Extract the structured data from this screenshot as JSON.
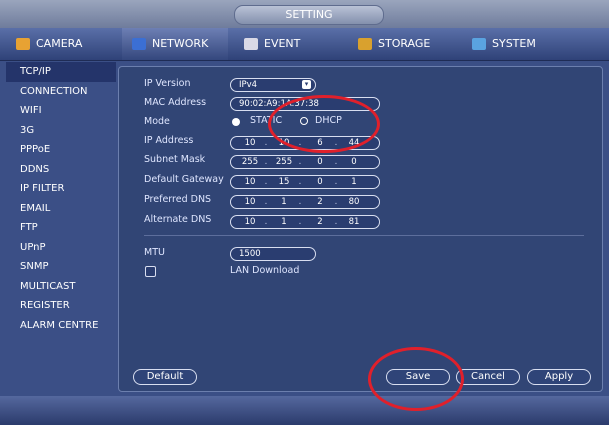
{
  "window": {
    "title": "SETTING"
  },
  "tabs": [
    {
      "label": "CAMERA",
      "icon": "camera-icon",
      "active": false
    },
    {
      "label": "NETWORK",
      "icon": "network-icon",
      "active": true
    },
    {
      "label": "EVENT",
      "icon": "event-icon",
      "active": false
    },
    {
      "label": "STORAGE",
      "icon": "storage-icon",
      "active": false
    },
    {
      "label": "SYSTEM",
      "icon": "system-icon",
      "active": false
    }
  ],
  "sidebar": {
    "items": [
      {
        "label": "TCP/IP",
        "active": true
      },
      {
        "label": "CONNECTION"
      },
      {
        "label": "WIFI"
      },
      {
        "label": "3G"
      },
      {
        "label": "PPPoE"
      },
      {
        "label": "DDNS"
      },
      {
        "label": "IP FILTER"
      },
      {
        "label": "EMAIL"
      },
      {
        "label": "FTP"
      },
      {
        "label": "UPnP"
      },
      {
        "label": "SNMP"
      },
      {
        "label": "MULTICAST"
      },
      {
        "label": "REGISTER"
      },
      {
        "label": "ALARM CENTRE"
      }
    ]
  },
  "form": {
    "ip_version": {
      "label": "IP Version",
      "value": "IPv4"
    },
    "mac_address": {
      "label": "MAC Address",
      "value": "90:02:A9:1A:37:38"
    },
    "mode": {
      "label": "Mode",
      "static_label": "STATIC",
      "dhcp_label": "DHCP",
      "selected": "STATIC"
    },
    "ip_address": {
      "label": "IP Address",
      "octets": [
        "10",
        "10",
        "6",
        "44"
      ]
    },
    "subnet_mask": {
      "label": "Subnet Mask",
      "octets": [
        "255",
        "255",
        "0",
        "0"
      ]
    },
    "default_gateway": {
      "label": "Default Gateway",
      "octets": [
        "10",
        "15",
        "0",
        "1"
      ]
    },
    "preferred_dns": {
      "label": "Preferred DNS",
      "octets": [
        "10",
        "1",
        "2",
        "80"
      ]
    },
    "alternate_dns": {
      "label": "Alternate DNS",
      "octets": [
        "10",
        "1",
        "2",
        "81"
      ]
    },
    "mtu": {
      "label": "MTU",
      "value": "1500"
    },
    "lan_download": {
      "label": "LAN Download",
      "checked": false
    }
  },
  "buttons": {
    "default": "Default",
    "save": "Save",
    "cancel": "Cancel",
    "apply": "Apply"
  },
  "colors": {
    "background": "#3b4f86",
    "panel": "#314575",
    "annotation": "#e0202b"
  }
}
